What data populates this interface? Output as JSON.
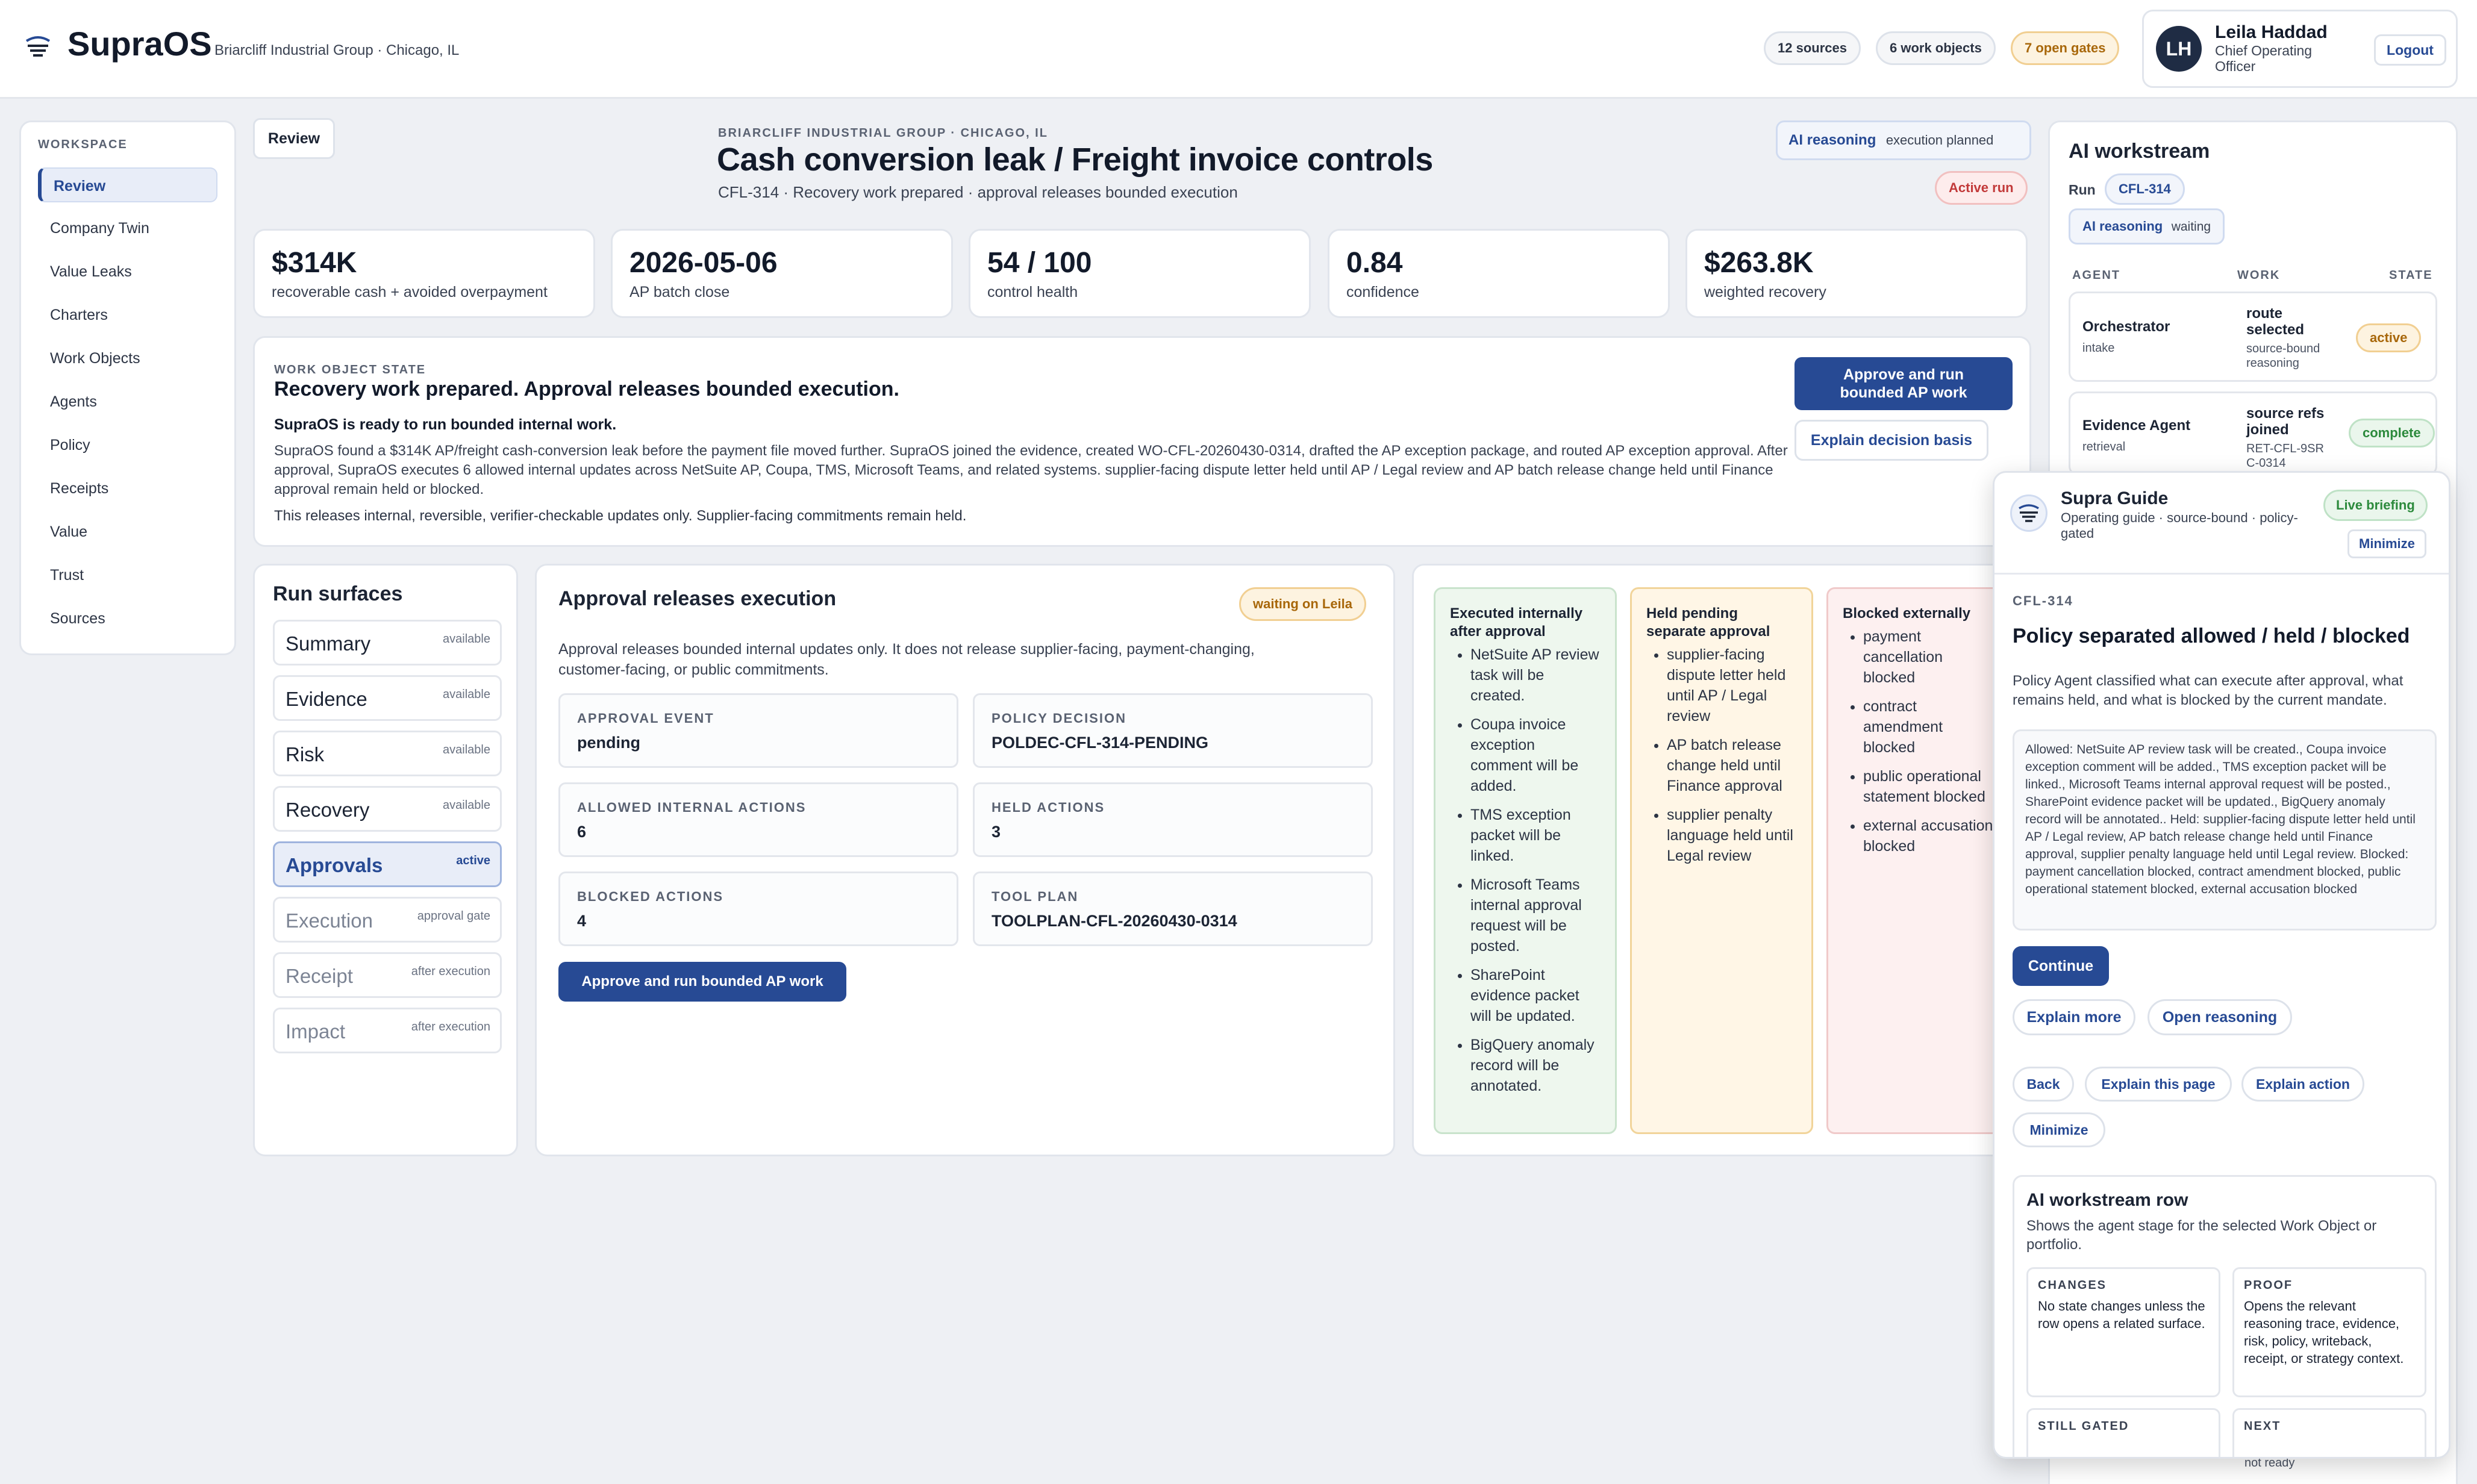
{
  "header": {
    "app_name": "SupraOS",
    "org_location": "Briarcliff Industrial Group · Chicago, IL",
    "badges": [
      "12 sources",
      "6 work objects",
      "7 open gates"
    ],
    "user": {
      "initials": "LH",
      "name": "Leila Haddad",
      "title": "Chief Operating Officer",
      "logout": "Logout"
    }
  },
  "sidebar": {
    "section": "WORKSPACE",
    "items": [
      "Review",
      "Company Twin",
      "Value Leaks",
      "Charters",
      "Work Objects",
      "Agents",
      "Policy",
      "Receipts",
      "Value",
      "Trust",
      "Sources"
    ],
    "active": "Review"
  },
  "main": {
    "review_tab": "Review",
    "eyebrow": "BRIARCLIFF INDUSTRIAL GROUP · CHICAGO, IL",
    "title": "Cash conversion leak / Freight invoice controls",
    "subtitle": "CFL-314 · Recovery work prepared · approval releases bounded execution",
    "reasoning_label": "AI reasoning",
    "reasoning_status": "execution planned",
    "active_run": "Active run",
    "kpis": [
      {
        "value": "$314K",
        "label": "recoverable cash + avoided overpayment"
      },
      {
        "value": "2026-05-06",
        "label": "AP batch close"
      },
      {
        "value": "54 / 100",
        "label": "control health"
      },
      {
        "value": "0.84",
        "label": "confidence"
      },
      {
        "value": "$263.8K",
        "label": "weighted recovery"
      }
    ],
    "state": {
      "eyebrow": "WORK OBJECT STATE",
      "headline": "Recovery work prepared. Approval releases bounded execution.",
      "ready": "SupraOS is ready to run bounded internal work.",
      "body": "SupraOS found a $314K AP/freight cash-conversion leak before the payment file moved further. SupraOS joined the evidence, created WO-CFL-20260430-0314, drafted the AP exception package, and routed AP exception approval. After approval, SupraOS executes 6 allowed internal updates across NetSuite AP, Coupa, TMS, Microsoft Teams, and related systems. supplier-facing dispute letter held until AP / Legal review and AP batch release change held until Finance approval remain held or blocked.",
      "note": "This releases internal, reversible, verifier-checkable updates only. Supplier-facing commitments remain held.",
      "approve_btn": "Approve and run bounded AP work",
      "explain_btn": "Explain decision basis"
    },
    "run_surfaces": {
      "title": "Run surfaces",
      "items": [
        {
          "name": "Summary",
          "status": "available"
        },
        {
          "name": "Evidence",
          "status": "available"
        },
        {
          "name": "Risk",
          "status": "available"
        },
        {
          "name": "Recovery",
          "status": "available"
        },
        {
          "name": "Approvals",
          "status": "active"
        },
        {
          "name": "Execution",
          "status": "approval gate"
        },
        {
          "name": "Receipt",
          "status": "after execution"
        },
        {
          "name": "Impact",
          "status": "after execution"
        }
      ]
    },
    "approval": {
      "title": "Approval releases execution",
      "waiting": "waiting on Leila",
      "desc": "Approval releases bounded internal updates only. It does not release supplier-facing, payment-changing, customer-facing, or public commitments.",
      "fields": [
        {
          "key": "APPROVAL EVENT",
          "value": "pending"
        },
        {
          "key": "POLICY DECISION",
          "value": "POLDEC-CFL-314-PENDING"
        },
        {
          "key": "ALLOWED INTERNAL ACTIONS",
          "value": "6"
        },
        {
          "key": "HELD ACTIONS",
          "value": "3"
        },
        {
          "key": "BLOCKED ACTIONS",
          "value": "4"
        },
        {
          "key": "TOOL PLAN",
          "value": "TOOLPLAN-CFL-20260430-0314"
        }
      ],
      "button": "Approve and run bounded AP work"
    },
    "columns": {
      "executed": {
        "title": "Executed internally after approval",
        "items": [
          "NetSuite AP review task will be created.",
          "Coupa invoice exception comment will be added.",
          "TMS exception packet will be linked.",
          "Microsoft Teams internal approval request will be posted.",
          "SharePoint evidence packet will be updated.",
          "BigQuery anomaly record will be annotated."
        ]
      },
      "held": {
        "title": "Held pending separate approval",
        "items": [
          "supplier-facing dispute letter held until AP / Legal review",
          "AP batch release change held until Finance approval",
          "supplier penalty language held until Legal review"
        ]
      },
      "blocked": {
        "title": "Blocked externally",
        "items": [
          "payment cancellation blocked",
          "contract amendment blocked",
          "public operational statement blocked",
          "external accusation blocked"
        ]
      }
    }
  },
  "workstream": {
    "title": "AI workstream",
    "run_label": "Run",
    "run_id": "CFL-314",
    "reasoning_label": "AI reasoning",
    "reasoning_status": "waiting",
    "headers": [
      "AGENT",
      "WORK",
      "STATE"
    ],
    "rows": [
      {
        "agent": "Orchestrator",
        "sub": "intake",
        "work": "route selected",
        "work_sub": "source-bound reasoning",
        "state": "active"
      },
      {
        "agent": "Evidence Agent",
        "sub": "retrieval",
        "work": "source refs joined",
        "work_sub": "RET-CFL-9SR C-0314",
        "state": "complete"
      }
    ],
    "bottom_left": "...",
    "bottom_right": "not ready"
  },
  "guide": {
    "title": "Supra Guide",
    "subtitle": "Operating guide · source-bound · policy-gated",
    "live": "Live briefing",
    "minimize_top": "Minimize",
    "run_id": "CFL-314",
    "heading": "Policy separated allowed / held / blocked",
    "desc": "Policy Agent classified what can execute after approval, what remains held, and what is blocked by the current mandate.",
    "box": "Allowed: NetSuite AP review task will be created., Coupa invoice exception comment will be added., TMS exception packet will be linked., Microsoft Teams internal approval request will be posted., SharePoint evidence packet will be updated., BigQuery anomaly record will be annotated.. Held: supplier-facing dispute letter held until AP / Legal review, AP batch release change held until Finance approval, supplier penalty language held until Legal review. Blocked: payment cancellation blocked, contract amendment blocked, public operational statement blocked, external accusation blocked",
    "continue": "Continue",
    "explain_more": "Explain more",
    "open_reasoning": "Open reasoning",
    "back": "Back",
    "explain_page": "Explain this page",
    "explain_action": "Explain action",
    "minimize": "Minimize",
    "row_title": "AI workstream row",
    "row_desc": "Shows the agent stage for the selected Work Object or portfolio.",
    "changes_key": "CHANGES",
    "changes_val": "No state changes unless the row opens a related surface.",
    "proof_key": "PROOF",
    "proof_val": "Opens the relevant reasoning trace, evidence, risk, policy, writeback, receipt, or strategy context.",
    "gated_key": "STILL GATED",
    "next_key": "NEXT"
  },
  "colors": {
    "primary": "#274a94",
    "amber": "#c77d12",
    "green": "#2c8a3c",
    "red": "#c23a3a"
  }
}
